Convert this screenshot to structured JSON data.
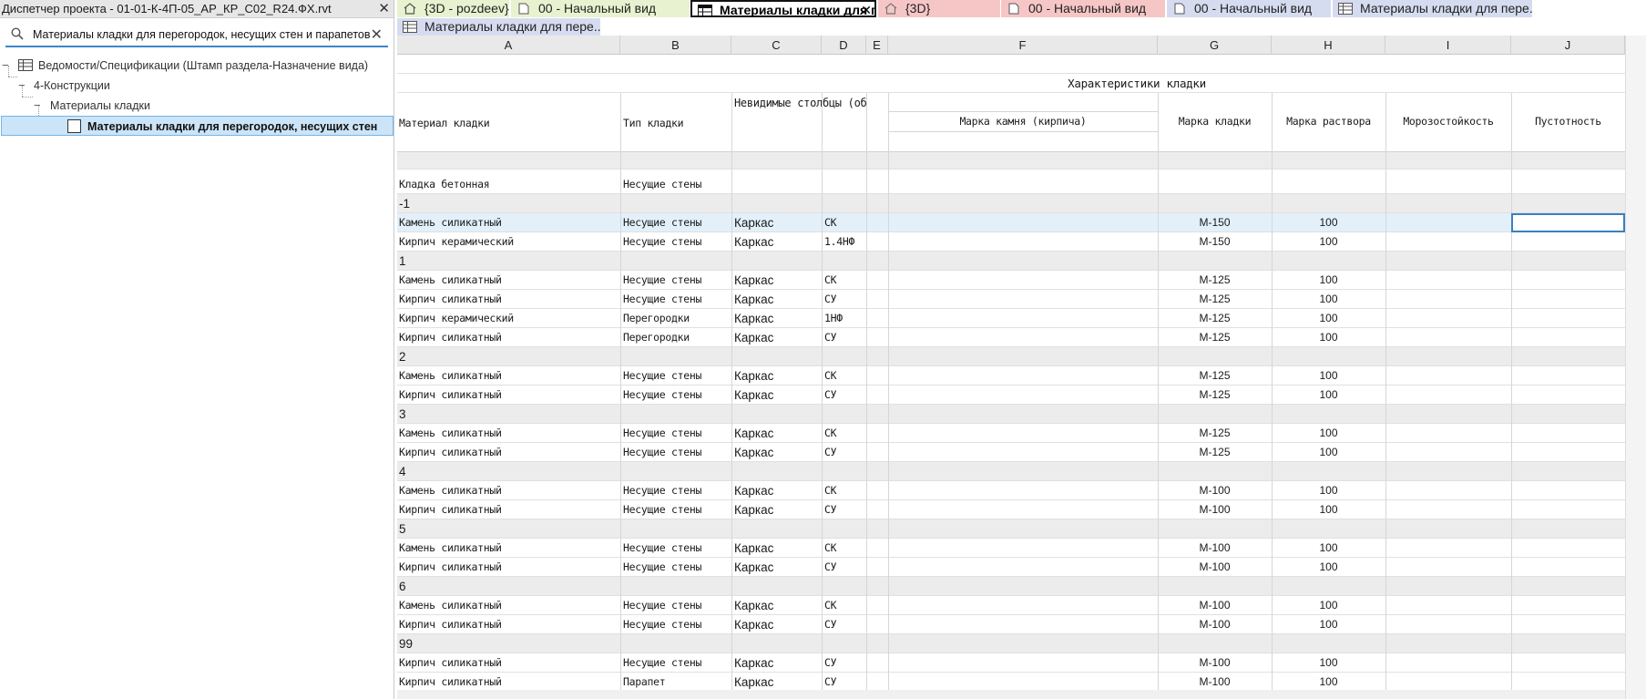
{
  "browser": {
    "title": "Диспетчер проекта - 01-01-К-4П-05_АР_КР_С02_R24.ФХ.rvt",
    "search_value": "Материалы кладки для перегородок, несущих стен и парапетов",
    "tree": [
      {
        "label": "Ведомости/Спецификации (Штамп раздела-Назначение вида)",
        "toggle": "−"
      },
      {
        "label": "4-Конструкции",
        "toggle": "−"
      },
      {
        "label": "Материалы кладки",
        "toggle": "−"
      },
      {
        "label": "Материалы кладки для перегородок, несущих стен",
        "toggle": ""
      }
    ]
  },
  "tabs": {
    "row1": [
      {
        "label": "{3D - pozdeev}",
        "icon": "home-icon",
        "color": "#e8f2d0"
      },
      {
        "label": "00 - Начальный вид",
        "icon": "view-icon",
        "color": "#e8f2d0"
      },
      {
        "label": "Материалы кладки для пе...",
        "icon": "schedule-icon",
        "color": "#ffffff",
        "active": true
      },
      {
        "label": "{3D}",
        "icon": "home-icon",
        "color": "#f6c6c6"
      },
      {
        "label": "00 - Начальный вид",
        "icon": "view-icon",
        "color": "#f6c6c6"
      },
      {
        "label": "00 - Начальный вид",
        "icon": "view-icon",
        "color": "#d6dcf0"
      },
      {
        "label": "Материалы кладки для пере...",
        "icon": "schedule-icon",
        "color": "#d6dcf0"
      }
    ],
    "row2": [
      {
        "label": "Материалы кладки для пере...",
        "icon": "schedule-icon",
        "color": "#d6dcf0"
      }
    ]
  },
  "columns": [
    "A",
    "B",
    "C",
    "D",
    "E",
    "F",
    "G",
    "H",
    "I",
    "J"
  ],
  "header": {
    "group_title": "Характеристики кладки",
    "material": "Материал кладки",
    "type": "Тип кладки",
    "hidden_cols": "Невидимые столбцы (об",
    "stone_mark": "Марка камня (кирпича)",
    "masonry_mark": "Марка кладки",
    "mortar_mark": "Марка раствора",
    "frost": "Морозостойкость",
    "voids": "Пустотность"
  },
  "rows": [
    {
      "kind": "data",
      "a": "Кладка бетонная",
      "b": "Несущие стены",
      "c": "",
      "d": "",
      "g": "",
      "h": ""
    },
    {
      "kind": "group",
      "a": "-1"
    },
    {
      "kind": "data",
      "a": "Камень силикатный",
      "b": "Несущие стены",
      "c": "Каркас",
      "d": "СК",
      "g": "М-150",
      "h": "100",
      "highlight": true
    },
    {
      "kind": "data",
      "a": "Кирпич керамический",
      "b": "Несущие стены",
      "c": "Каркас",
      "d": "1.4НФ",
      "g": "М-150",
      "h": "100"
    },
    {
      "kind": "group",
      "a": "1"
    },
    {
      "kind": "data",
      "a": "Камень силикатный",
      "b": "Несущие стены",
      "c": "Каркас",
      "d": "СК",
      "g": "М-125",
      "h": "100"
    },
    {
      "kind": "data",
      "a": "Кирпич силикатный",
      "b": "Несущие стены",
      "c": "Каркас",
      "d": "СУ",
      "g": "М-125",
      "h": "100"
    },
    {
      "kind": "data",
      "a": "Кирпич керамический",
      "b": "Перегородки",
      "c": "Каркас",
      "d": "1НФ",
      "g": "М-125",
      "h": "100"
    },
    {
      "kind": "data",
      "a": "Кирпич силикатный",
      "b": "Перегородки",
      "c": "Каркас",
      "d": "СУ",
      "g": "М-125",
      "h": "100"
    },
    {
      "kind": "group",
      "a": "2"
    },
    {
      "kind": "data",
      "a": "Камень силикатный",
      "b": "Несущие стены",
      "c": "Каркас",
      "d": "СК",
      "g": "М-125",
      "h": "100"
    },
    {
      "kind": "data",
      "a": "Кирпич силикатный",
      "b": "Несущие стены",
      "c": "Каркас",
      "d": "СУ",
      "g": "М-125",
      "h": "100"
    },
    {
      "kind": "group",
      "a": "3"
    },
    {
      "kind": "data",
      "a": "Камень силикатный",
      "b": "Несущие стены",
      "c": "Каркас",
      "d": "СК",
      "g": "М-125",
      "h": "100"
    },
    {
      "kind": "data",
      "a": "Кирпич силикатный",
      "b": "Несущие стены",
      "c": "Каркас",
      "d": "СУ",
      "g": "М-125",
      "h": "100"
    },
    {
      "kind": "group",
      "a": "4"
    },
    {
      "kind": "data",
      "a": "Камень силикатный",
      "b": "Несущие стены",
      "c": "Каркас",
      "d": "СК",
      "g": "М-100",
      "h": "100"
    },
    {
      "kind": "data",
      "a": "Кирпич силикатный",
      "b": "Несущие стены",
      "c": "Каркас",
      "d": "СУ",
      "g": "М-100",
      "h": "100"
    },
    {
      "kind": "group",
      "a": "5"
    },
    {
      "kind": "data",
      "a": "Камень силикатный",
      "b": "Несущие стены",
      "c": "Каркас",
      "d": "СК",
      "g": "М-100",
      "h": "100"
    },
    {
      "kind": "data",
      "a": "Кирпич силикатный",
      "b": "Несущие стены",
      "c": "Каркас",
      "d": "СУ",
      "g": "М-100",
      "h": "100"
    },
    {
      "kind": "group",
      "a": "6"
    },
    {
      "kind": "data",
      "a": "Камень силикатный",
      "b": "Несущие стены",
      "c": "Каркас",
      "d": "СК",
      "g": "М-100",
      "h": "100"
    },
    {
      "kind": "data",
      "a": "Кирпич силикатный",
      "b": "Несущие стены",
      "c": "Каркас",
      "d": "СУ",
      "g": "М-100",
      "h": "100"
    },
    {
      "kind": "group",
      "a": "99"
    },
    {
      "kind": "data",
      "a": "Кирпич силикатный",
      "b": "Несущие стены",
      "c": "Каркас",
      "d": "СУ",
      "g": "М-100",
      "h": "100"
    },
    {
      "kind": "data",
      "a": "Кирпич силикатный",
      "b": "Парапет",
      "c": "Каркас",
      "d": "СУ",
      "g": "М-100",
      "h": "100"
    }
  ],
  "colors": {
    "accent": "#3b7fc4",
    "group_row": "#ececec",
    "selection": "#cce4f7"
  }
}
